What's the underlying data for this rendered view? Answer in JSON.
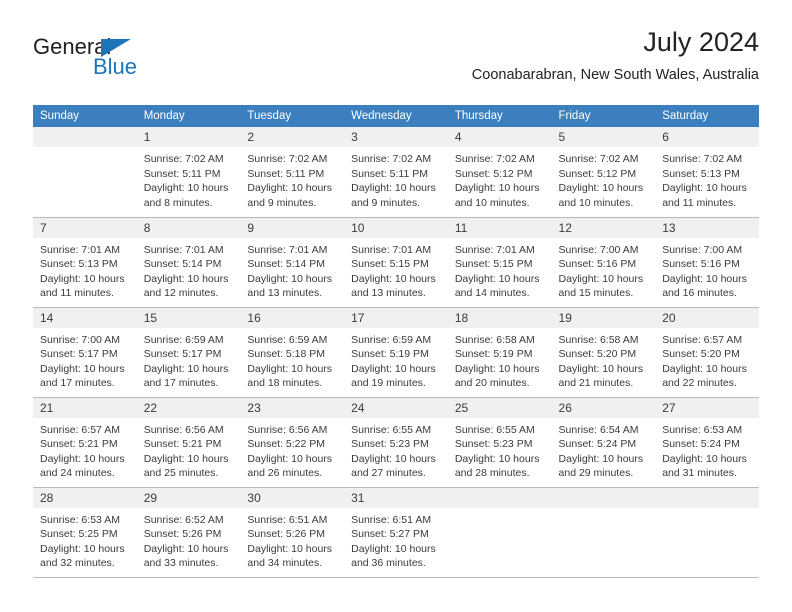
{
  "brand": {
    "name_dark": "General",
    "name_blue": "Blue",
    "accent_color": "#1b75bb"
  },
  "header": {
    "title": "July 2024",
    "subtitle": "Coonabarabran, New South Wales, Australia"
  },
  "theme": {
    "header_bg": "#3c7fbf",
    "header_text": "#ffffff",
    "daynum_bg": "#f0f0f0",
    "cell_bg": "#ffffff",
    "grid_line": "#b9b9b9",
    "body_text": "#3b3b3b"
  },
  "weekdays": [
    "Sunday",
    "Monday",
    "Tuesday",
    "Wednesday",
    "Thursday",
    "Friday",
    "Saturday"
  ],
  "labels": {
    "sunrise": "Sunrise:",
    "sunset": "Sunset:",
    "daylight": "Daylight:"
  },
  "weeks": [
    [
      {
        "day": "",
        "sunrise": "",
        "sunset": "",
        "daylight": "",
        "empty": true
      },
      {
        "day": "1",
        "sunrise": "Sunrise: 7:02 AM",
        "sunset": "Sunset: 5:11 PM",
        "daylight": "Daylight: 10 hours and 8 minutes."
      },
      {
        "day": "2",
        "sunrise": "Sunrise: 7:02 AM",
        "sunset": "Sunset: 5:11 PM",
        "daylight": "Daylight: 10 hours and 9 minutes."
      },
      {
        "day": "3",
        "sunrise": "Sunrise: 7:02 AM",
        "sunset": "Sunset: 5:11 PM",
        "daylight": "Daylight: 10 hours and 9 minutes."
      },
      {
        "day": "4",
        "sunrise": "Sunrise: 7:02 AM",
        "sunset": "Sunset: 5:12 PM",
        "daylight": "Daylight: 10 hours and 10 minutes."
      },
      {
        "day": "5",
        "sunrise": "Sunrise: 7:02 AM",
        "sunset": "Sunset: 5:12 PM",
        "daylight": "Daylight: 10 hours and 10 minutes."
      },
      {
        "day": "6",
        "sunrise": "Sunrise: 7:02 AM",
        "sunset": "Sunset: 5:13 PM",
        "daylight": "Daylight: 10 hours and 11 minutes."
      }
    ],
    [
      {
        "day": "7",
        "sunrise": "Sunrise: 7:01 AM",
        "sunset": "Sunset: 5:13 PM",
        "daylight": "Daylight: 10 hours and 11 minutes."
      },
      {
        "day": "8",
        "sunrise": "Sunrise: 7:01 AM",
        "sunset": "Sunset: 5:14 PM",
        "daylight": "Daylight: 10 hours and 12 minutes."
      },
      {
        "day": "9",
        "sunrise": "Sunrise: 7:01 AM",
        "sunset": "Sunset: 5:14 PM",
        "daylight": "Daylight: 10 hours and 13 minutes."
      },
      {
        "day": "10",
        "sunrise": "Sunrise: 7:01 AM",
        "sunset": "Sunset: 5:15 PM",
        "daylight": "Daylight: 10 hours and 13 minutes."
      },
      {
        "day": "11",
        "sunrise": "Sunrise: 7:01 AM",
        "sunset": "Sunset: 5:15 PM",
        "daylight": "Daylight: 10 hours and 14 minutes."
      },
      {
        "day": "12",
        "sunrise": "Sunrise: 7:00 AM",
        "sunset": "Sunset: 5:16 PM",
        "daylight": "Daylight: 10 hours and 15 minutes."
      },
      {
        "day": "13",
        "sunrise": "Sunrise: 7:00 AM",
        "sunset": "Sunset: 5:16 PM",
        "daylight": "Daylight: 10 hours and 16 minutes."
      }
    ],
    [
      {
        "day": "14",
        "sunrise": "Sunrise: 7:00 AM",
        "sunset": "Sunset: 5:17 PM",
        "daylight": "Daylight: 10 hours and 17 minutes."
      },
      {
        "day": "15",
        "sunrise": "Sunrise: 6:59 AM",
        "sunset": "Sunset: 5:17 PM",
        "daylight": "Daylight: 10 hours and 17 minutes."
      },
      {
        "day": "16",
        "sunrise": "Sunrise: 6:59 AM",
        "sunset": "Sunset: 5:18 PM",
        "daylight": "Daylight: 10 hours and 18 minutes."
      },
      {
        "day": "17",
        "sunrise": "Sunrise: 6:59 AM",
        "sunset": "Sunset: 5:19 PM",
        "daylight": "Daylight: 10 hours and 19 minutes."
      },
      {
        "day": "18",
        "sunrise": "Sunrise: 6:58 AM",
        "sunset": "Sunset: 5:19 PM",
        "daylight": "Daylight: 10 hours and 20 minutes."
      },
      {
        "day": "19",
        "sunrise": "Sunrise: 6:58 AM",
        "sunset": "Sunset: 5:20 PM",
        "daylight": "Daylight: 10 hours and 21 minutes."
      },
      {
        "day": "20",
        "sunrise": "Sunrise: 6:57 AM",
        "sunset": "Sunset: 5:20 PM",
        "daylight": "Daylight: 10 hours and 22 minutes."
      }
    ],
    [
      {
        "day": "21",
        "sunrise": "Sunrise: 6:57 AM",
        "sunset": "Sunset: 5:21 PM",
        "daylight": "Daylight: 10 hours and 24 minutes."
      },
      {
        "day": "22",
        "sunrise": "Sunrise: 6:56 AM",
        "sunset": "Sunset: 5:21 PM",
        "daylight": "Daylight: 10 hours and 25 minutes."
      },
      {
        "day": "23",
        "sunrise": "Sunrise: 6:56 AM",
        "sunset": "Sunset: 5:22 PM",
        "daylight": "Daylight: 10 hours and 26 minutes."
      },
      {
        "day": "24",
        "sunrise": "Sunrise: 6:55 AM",
        "sunset": "Sunset: 5:23 PM",
        "daylight": "Daylight: 10 hours and 27 minutes."
      },
      {
        "day": "25",
        "sunrise": "Sunrise: 6:55 AM",
        "sunset": "Sunset: 5:23 PM",
        "daylight": "Daylight: 10 hours and 28 minutes."
      },
      {
        "day": "26",
        "sunrise": "Sunrise: 6:54 AM",
        "sunset": "Sunset: 5:24 PM",
        "daylight": "Daylight: 10 hours and 29 minutes."
      },
      {
        "day": "27",
        "sunrise": "Sunrise: 6:53 AM",
        "sunset": "Sunset: 5:24 PM",
        "daylight": "Daylight: 10 hours and 31 minutes."
      }
    ],
    [
      {
        "day": "28",
        "sunrise": "Sunrise: 6:53 AM",
        "sunset": "Sunset: 5:25 PM",
        "daylight": "Daylight: 10 hours and 32 minutes."
      },
      {
        "day": "29",
        "sunrise": "Sunrise: 6:52 AM",
        "sunset": "Sunset: 5:26 PM",
        "daylight": "Daylight: 10 hours and 33 minutes."
      },
      {
        "day": "30",
        "sunrise": "Sunrise: 6:51 AM",
        "sunset": "Sunset: 5:26 PM",
        "daylight": "Daylight: 10 hours and 34 minutes."
      },
      {
        "day": "31",
        "sunrise": "Sunrise: 6:51 AM",
        "sunset": "Sunset: 5:27 PM",
        "daylight": "Daylight: 10 hours and 36 minutes."
      },
      {
        "day": "",
        "sunrise": "",
        "sunset": "",
        "daylight": "",
        "empty": true
      },
      {
        "day": "",
        "sunrise": "",
        "sunset": "",
        "daylight": "",
        "empty": true
      },
      {
        "day": "",
        "sunrise": "",
        "sunset": "",
        "daylight": "",
        "empty": true
      }
    ]
  ]
}
